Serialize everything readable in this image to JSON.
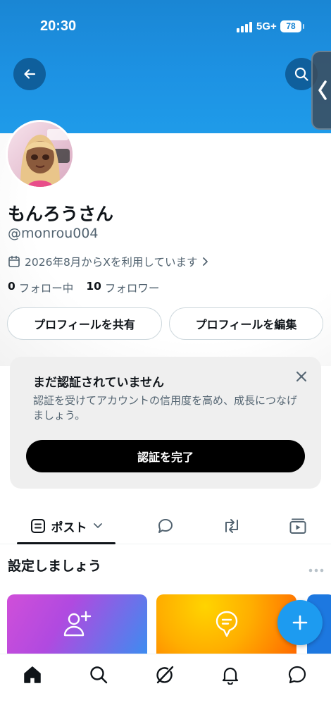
{
  "status_bar": {
    "time": "20:30",
    "network": "5G+",
    "battery": "78"
  },
  "profile": {
    "display_name": "もんろうさん",
    "handle": "@monrou004",
    "joined": "2026年8月からXを利用しています",
    "following_count": "0",
    "following_label": "フォロー中",
    "followers_count": "10",
    "followers_label": "フォロワー"
  },
  "buttons": {
    "share_profile": "プロフィールを共有",
    "edit_profile": "プロフィールを編集"
  },
  "verify_card": {
    "title": "まだ認証されていません",
    "body": "認証を受けてアカウントの信用度を高め、成長につなげましょう。",
    "button": "認証を完了"
  },
  "tabs": {
    "posts_label": "ポスト"
  },
  "setup": {
    "title": "設定しましょう"
  },
  "colors": {
    "accent": "#1d9bf0",
    "banner": "#1a86d4",
    "text": "#0f1419",
    "secondary_text": "#536471"
  }
}
